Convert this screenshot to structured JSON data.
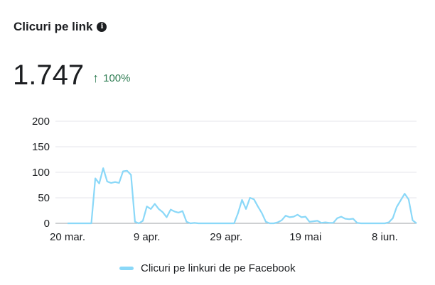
{
  "header": {
    "title": "Clicuri pe link",
    "info_icon": "info-circle-icon"
  },
  "metric": {
    "value": "1.747",
    "trend_icon": "arrow-up-icon",
    "change": "100%",
    "trend_color": "#2f7d53"
  },
  "chart_data": {
    "type": "line",
    "title": "",
    "xlabel": "",
    "ylabel": "",
    "ylim": [
      0,
      200
    ],
    "yticks": [
      0,
      50,
      100,
      150,
      200
    ],
    "grid": true,
    "legend_position": "bottom-center",
    "x_tick_labels": [
      "20 mar.",
      "9 apr.",
      "29 apr.",
      "19 mai",
      "8 iun."
    ],
    "x_tick_days": [
      0,
      20,
      40,
      60,
      80
    ],
    "series": [
      {
        "name": "Clicuri pe linkuri de pe Facebook",
        "color": "#8ad8f8",
        "values": [
          0,
          0,
          0,
          0,
          0,
          0,
          0,
          88,
          78,
          108,
          82,
          79,
          81,
          79,
          102,
          103,
          95,
          3,
          0,
          5,
          33,
          28,
          38,
          28,
          22,
          12,
          27,
          23,
          21,
          24,
          3,
          0,
          1,
          0,
          0,
          0,
          0,
          0,
          0,
          0,
          0,
          0,
          0,
          20,
          46,
          28,
          50,
          47,
          33,
          20,
          3,
          0,
          0,
          2,
          6,
          15,
          12,
          13,
          17,
          12,
          13,
          3,
          4,
          5,
          1,
          2,
          1,
          1,
          10,
          13,
          9,
          8,
          9,
          1,
          0,
          0,
          0,
          0,
          0,
          0,
          0,
          2,
          10,
          32,
          45,
          58,
          47,
          6,
          0,
          0,
          0,
          0,
          0,
          0
        ]
      }
    ]
  },
  "legend": {
    "label": "Clicuri pe linkuri de pe Facebook"
  }
}
